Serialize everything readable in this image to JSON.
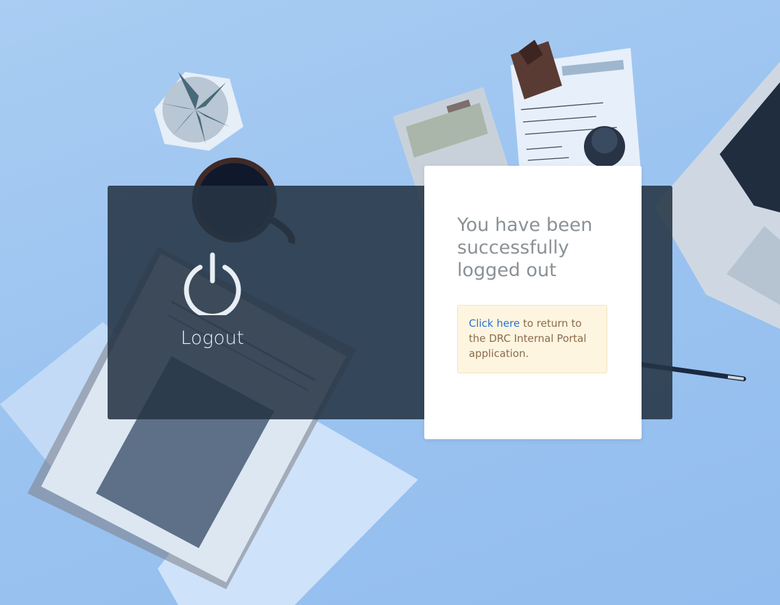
{
  "logout_panel": {
    "label": "Logout",
    "icon": "power-icon"
  },
  "message_card": {
    "title": "You have been successfully logged out",
    "notice": {
      "link_text": "Click here",
      "text_after_link": " to return to the DRC Internal Portal application."
    }
  },
  "colors": {
    "background_overlay": "#9cc4f0",
    "dark_panel": "#263444",
    "card": "#ffffff",
    "title_text": "#8a9196",
    "notice_background": "#fdf5df",
    "notice_text": "#8b6b4d",
    "link": "#2a6fd6"
  }
}
